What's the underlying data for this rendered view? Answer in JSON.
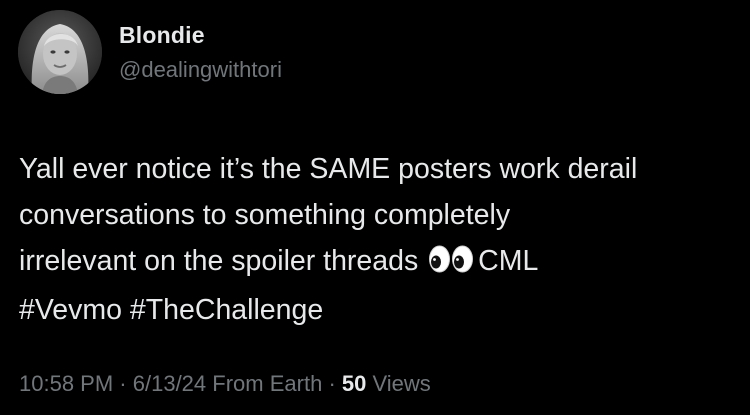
{
  "author": {
    "display_name": "Blondie",
    "handle": "@dealingwithtori",
    "avatar_icon": "profile-photo"
  },
  "tweet": {
    "lines": [
      "Yall ever notice it’s the SAME posters work derail",
      "conversations to something completely",
      "irrelevant on the spoiler threads"
    ],
    "emoji_name": "eyes-emoji",
    "after_emoji": "CML",
    "hashtags": [
      "#Vevmo",
      "#TheChallenge"
    ]
  },
  "meta": {
    "time": "10:58 PM",
    "separator": "·",
    "date": "6/13/24",
    "source": "From Earth",
    "views_count": "50",
    "views_label": "Views"
  },
  "colors": {
    "background": "#000000",
    "primary_text": "#e7e9ea",
    "secondary_text": "#71767b"
  }
}
